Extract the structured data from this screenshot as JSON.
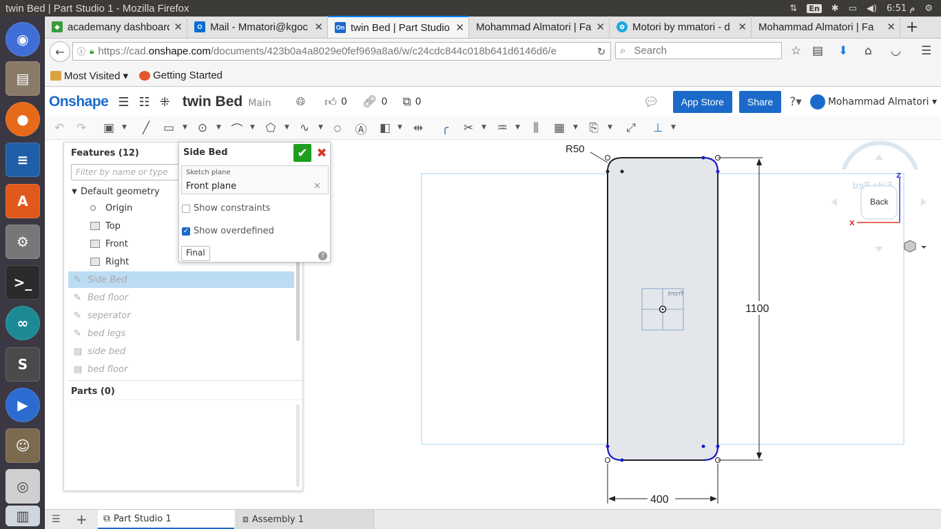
{
  "system": {
    "window_title": "twin Bed | Part Studio 1 - Mozilla Firefox",
    "keyboard": "En",
    "clock": "6:51 م"
  },
  "browser": {
    "tabs": [
      {
        "label": "academany dashboard",
        "fav_color": "#3a9b3a"
      },
      {
        "label": "Mail - Mmatori@kgoc",
        "fav_color": "#0a6ed1"
      },
      {
        "label": "twin Bed | Part Studio 1",
        "fav_color": "#1b6ac9"
      },
      {
        "label": "Mohammad Almatori | Fa",
        "fav_color": ""
      },
      {
        "label": "Motori by mmatori - d",
        "fav_color": "#1ea7e0"
      },
      {
        "label": "Mohammad Almatori | Fa",
        "fav_color": ""
      }
    ],
    "url_prefix": "https://cad.",
    "url_domain": "onshape.com",
    "url_rest": "/documents/423b0a4a8029e0fef969a8a6/w/c24cdc844c018b641d6146d6/e",
    "search_placeholder": "Search",
    "bookmarks": [
      {
        "label": "Most Visited ▾"
      },
      {
        "label": "Getting Started"
      }
    ]
  },
  "onshape": {
    "logo": "Onshape",
    "doc_name": "twin Bed",
    "branch": "Main",
    "likes": "0",
    "links": "0",
    "copies": "0",
    "app_store": "App Store",
    "share": "Share",
    "user": "Mohammad Almatori"
  },
  "features": {
    "header": "Features (12)",
    "filter_placeholder": "Filter by name or type",
    "default_geometry": "Default geometry",
    "origin": "Origin",
    "planes": [
      "Top",
      "Front",
      "Right"
    ],
    "items": [
      {
        "label": "Side Bed",
        "kind": "sketch"
      },
      {
        "label": "Bed floor",
        "kind": "sketch"
      },
      {
        "label": "seperator",
        "kind": "sketch"
      },
      {
        "label": "bed legs",
        "kind": "sketch"
      },
      {
        "label": "side bed",
        "kind": "extrude"
      },
      {
        "label": "bed floor",
        "kind": "extrude"
      }
    ],
    "parts": "Parts (0)"
  },
  "sketch_dialog": {
    "title": "Side Bed",
    "plane_label": "Sketch plane",
    "plane_value": "Front plane",
    "show_constraints": "Show constraints",
    "show_constraints_checked": false,
    "show_overdefined": "Show overdefined",
    "show_overdefined_checked": true,
    "final": "Final"
  },
  "sketch": {
    "radius_label": "R50",
    "height_label": "1100",
    "width_label": "400",
    "plane_tag": "Front",
    "view_cube_face": "Back",
    "view_cube_mirrored_text": "Side Bed",
    "axis_x": "X",
    "axis_z": "Z"
  },
  "bottom_tabs": [
    {
      "label": "Part Studio 1"
    },
    {
      "label": "Assembly 1"
    }
  ]
}
